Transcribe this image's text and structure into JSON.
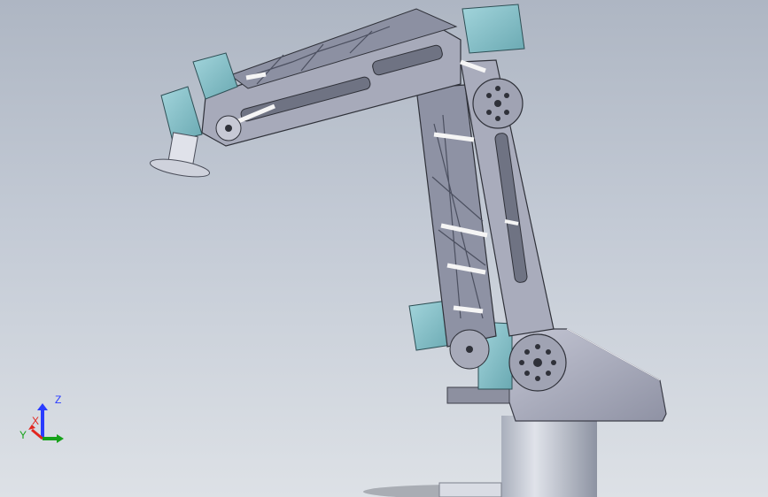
{
  "viewport": {
    "background_top": "#aeb6c3",
    "background_bottom": "#dde1e6"
  },
  "colors": {
    "motor_teal": "#8fc7cf",
    "frame_gray": "#9a9cad",
    "frame_light": "#b9bccb",
    "base_cylinder": "#c9ced8",
    "rod_white": "#f2f2f2"
  },
  "axis_triad": {
    "z_label": "Z",
    "x_label": "X",
    "y_label": "Y",
    "z_color": "#2a3cff",
    "x_color": "#e2261f",
    "y_color": "#16a21a"
  }
}
